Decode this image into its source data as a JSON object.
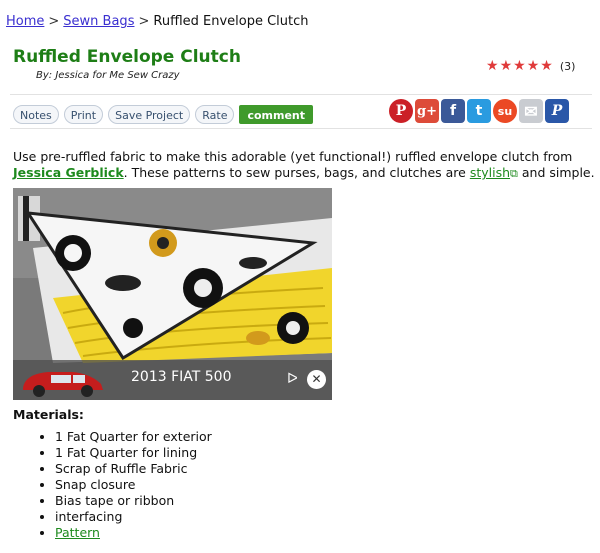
{
  "breadcrumb": {
    "home": "Home",
    "category": "Sewn Bags",
    "current": "Ruffled Envelope Clutch",
    "separator": ">"
  },
  "project": {
    "title": "Ruffled Envelope Clutch",
    "author": "By: Jessica for Me Sew Crazy"
  },
  "rating": {
    "stars": 5,
    "count": "(3)",
    "star_color": "#e03a3a"
  },
  "actions": {
    "notes": "Notes",
    "print": "Print",
    "save": "Save Project",
    "rate": "Rate",
    "comment": "comment"
  },
  "social": [
    {
      "name": "pinterest",
      "glyph": "P",
      "color": "#cb2027"
    },
    {
      "name": "google-plus",
      "glyph": "g+",
      "color": "#dd4b39"
    },
    {
      "name": "facebook",
      "glyph": "f",
      "color": "#3b5998"
    },
    {
      "name": "twitter",
      "glyph": "t",
      "color": "#2a9be0"
    },
    {
      "name": "stumbleupon",
      "glyph": "su",
      "color": "#eb4924"
    },
    {
      "name": "email",
      "glyph": "✉",
      "color": "#c9ccd1"
    },
    {
      "name": "pinterest-alt",
      "glyph": "P",
      "color": "#2a57a8"
    }
  ],
  "description": {
    "part1": "Use pre-ruffled fabric to make this adorable (yet functional!) ruffled envelope clutch from",
    "author_link": "Jessica Gerblick",
    "part2": ". These patterns to sew purses, bags, and clutches are",
    "stylish_link": "stylish",
    "part3": "and simple."
  },
  "ad": {
    "label": "2013 FIAT 500"
  },
  "materials": {
    "title": "Materials:",
    "items": [
      "1 Fat Quarter for exterior",
      "1 Fat Quarter for lining",
      "Scrap of Ruffle Fabric",
      "Snap closure",
      "Bias tape or ribbon",
      "interfacing"
    ],
    "pattern_link": "Pattern"
  }
}
